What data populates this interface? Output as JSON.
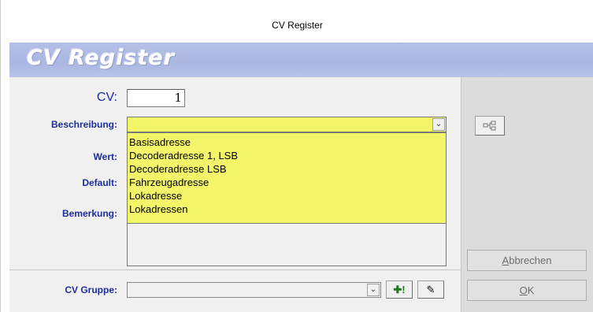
{
  "window": {
    "title": "CV Register"
  },
  "banner": {
    "title": "CV Register"
  },
  "form": {
    "cv_label": "CV:",
    "cv_value": "1",
    "beschreibung_label": "Beschreibung:",
    "wert_label": "Wert:",
    "default_label": "Default:",
    "bemerkung_label": "Bemerkung:",
    "cv_gruppe_label": "CV Gruppe:",
    "beschreibung_value": "",
    "cv_gruppe_value": ""
  },
  "dropdown": {
    "items": [
      "Basisadresse",
      "Decoderadresse 1, LSB",
      "Decoderadresse LSB",
      "Fahrzeugadresse",
      "Lokadresse",
      "Lokadressen"
    ]
  },
  "buttons": {
    "cancel_prefix": "",
    "cancel_accel": "A",
    "cancel_rest": "bbrechen",
    "ok_accel": "O",
    "ok_rest": "K",
    "add_label": "✚!",
    "edit_label": "✎"
  },
  "icons": {
    "combo_arrow": "chevron-down-icon",
    "tree": "tree-structure-icon",
    "add": "add-icon",
    "edit": "edit-note-icon"
  },
  "colors": {
    "highlight_yellow": "#f5f569",
    "label_blue": "#1a2e9e",
    "banner_blue": "#aab7e1"
  }
}
